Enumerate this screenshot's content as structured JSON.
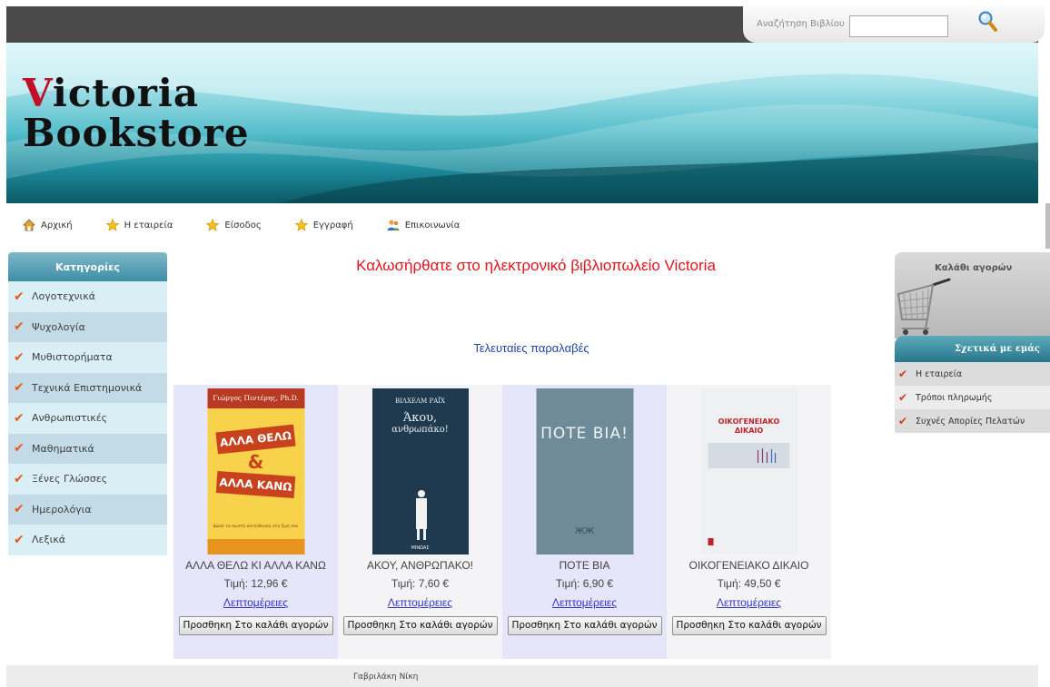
{
  "search": {
    "label": "Αναζήτηση Βιβλίου",
    "value": ""
  },
  "logo": {
    "initial": "V",
    "line1_rest": "ictoria",
    "line2": "Bookstore"
  },
  "nav": [
    {
      "label": "Αρχική",
      "icon": "home-icon"
    },
    {
      "label": "Η εταιρεία",
      "icon": "star-icon"
    },
    {
      "label": "Είσοδος",
      "icon": "star-icon"
    },
    {
      "label": "Εγγραφή",
      "icon": "star-icon"
    },
    {
      "label": "Επικοινωνία",
      "icon": "users-icon"
    }
  ],
  "categories": {
    "title": "Κατηγορίες",
    "items": [
      "Λογοτεχνικά",
      "Ψυχολογία",
      "Μυθιστορήματα",
      "Τεχνικά Επιστημονικά",
      "Ανθρωπιστικές",
      "Μαθηματικά",
      "Ξένες Γλώσσες",
      "Ημερολόγια",
      "Λεξικά"
    ]
  },
  "main": {
    "welcome": "Καλωσήρθατε στο ηλεκτρονικό βιβλιοπωλείο Victoria",
    "latest": "Τελευταίες παραλαβές"
  },
  "products": [
    {
      "title": "ΑΛΛΑ ΘΕΛΩ ΚΙ ΑΛΛΑ ΚΑΝΩ",
      "price": "Τιμή: 12,96 €",
      "details": "Λεπτομέρειες",
      "add": "Προσθηκη Στο καλάθι αγορών",
      "cover": {
        "author": "Γιώργος Πιντέρης, Ph.D.",
        "line1": "ΑΛΛΑ ΘΕΛΩ",
        "line2": "&",
        "line3": "ΑΛΛΑ ΚΑΝΩ",
        "tagline": "Δώσε το σωστό κατεύθυνση στη ζωή σου"
      }
    },
    {
      "title": "ΑΚΟΥ, ΑΝΘΡΩΠΑΚΟ!",
      "price": "Τιμή: 7,60 €",
      "details": "Λεπτομέρειες",
      "add": "Προσθηκη Στο καλάθι αγορών",
      "cover": {
        "author": "ΒΙΛΧΕΛΜ ΡΑΪΧ",
        "line1": "Άκου,",
        "line2": "ανθρωπάκο!",
        "publisher": "ΜΙΝΩΑΣ"
      }
    },
    {
      "title": "ΠΟΤΕ ΒΙΑ",
      "price": "Τιμή: 6,90 €",
      "details": "Λεπτομέρειες",
      "add": "Προσθηκη Στο καλάθι αγορών",
      "cover": {
        "line1": "ΠΟΤΕ ΒΙΑ!"
      }
    },
    {
      "title": "ΟΙΚΟΓΕΝΕΙΑΚΟ ΔΙΚΑΙΟ",
      "price": "Τιμή: 49,50 €",
      "details": "Λεπτομέρειες",
      "add": "Προσθηκη Στο καλάθι αγορών",
      "cover": {
        "line1": "ΟΙΚΟΓΕΝΕΙΑΚΟ",
        "line2": "ΔΙΚΑΙΟ"
      }
    }
  ],
  "cart": {
    "title": "Καλάθι αγορών",
    "icon": "shopping-cart-icon"
  },
  "about": {
    "title": "Σχετικά με εμάς",
    "items": [
      "Η εταιρεία",
      "Τρόποι πληρωμής",
      "Συχνές Απορίες Πελατών"
    ]
  },
  "footer": {
    "text": "Γαβριλάκη Νίκη"
  },
  "colors": {
    "welcome": "#e2141c",
    "latest": "#2244aa",
    "check": "#e85a1a",
    "link": "#3333cc"
  }
}
